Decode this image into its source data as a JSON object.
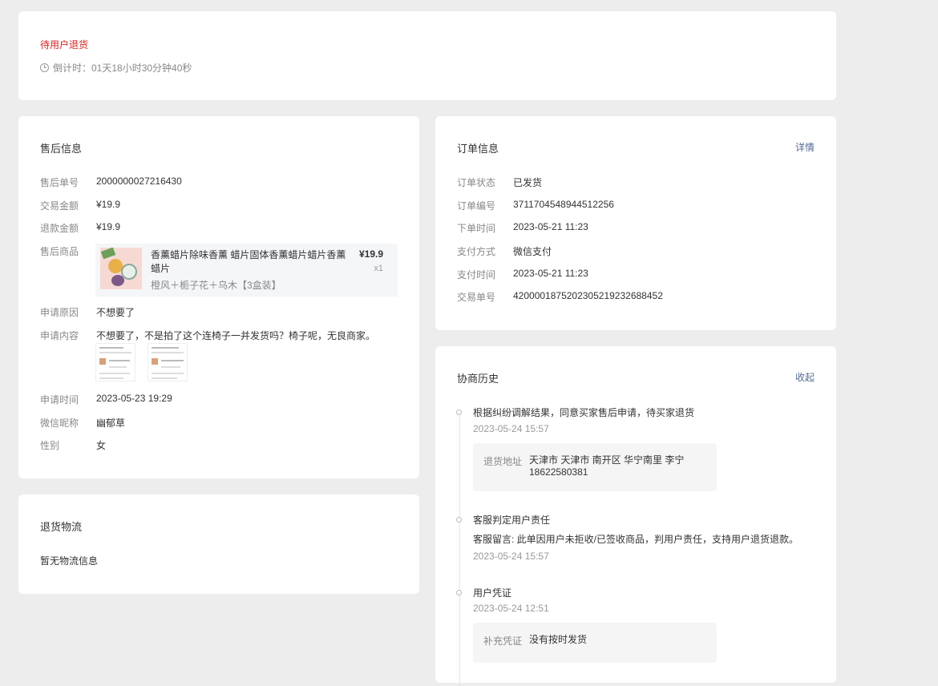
{
  "status": {
    "title": "待用户退货",
    "countdown": "倒计时：01天18小时30分钟40秒"
  },
  "after_sale": {
    "title": "售后信息",
    "rows": [
      {
        "label": "售后单号",
        "value": "2000000027216430"
      },
      {
        "label": "交易金额",
        "value": "¥19.9"
      },
      {
        "label": "退款金额",
        "value": "¥19.9"
      },
      {
        "label": "售后商品",
        "value": ""
      },
      {
        "label": "申请原因",
        "value": "不想要了"
      },
      {
        "label": "申请内容",
        "value": "不想要了，不是拍了这个连椅子一并发货吗？椅子呢，无良商家。"
      },
      {
        "label": "申请时间",
        "value": "2023-05-23 19:29"
      },
      {
        "label": "微信昵称",
        "value": "幽郁草"
      },
      {
        "label": "性别",
        "value": "女"
      }
    ],
    "product": {
      "name": "香薰蜡片除味香薰 蜡片固体香薰蜡片蜡片香薰 蜡片",
      "spec": "橙风＋栀子花＋乌木【3盒装】",
      "price": "¥19.9",
      "qty": "x1"
    }
  },
  "logistics": {
    "title": "退货物流",
    "empty_text": "暂无物流信息"
  },
  "order": {
    "title": "订单信息",
    "link": "详情",
    "rows": [
      {
        "label": "订单状态",
        "value": "已发货"
      },
      {
        "label": "订单编号",
        "value": "3711704548944512256"
      },
      {
        "label": "下单时间",
        "value": "2023-05-21 11:23"
      },
      {
        "label": "支付方式",
        "value": "微信支付"
      },
      {
        "label": "支付时间",
        "value": "2023-05-21 11:23"
      },
      {
        "label": "交易单号",
        "value": "4200001875202305219232688452"
      }
    ]
  },
  "history": {
    "title": "协商历史",
    "link": "收起",
    "items": [
      {
        "title": "根据纠纷调解结果，同意买家售后申请，待买家退货",
        "time": "2023-05-24 15:57",
        "box_label": "退货地址",
        "box_value": "天津市 天津市 南开区 华宁南里 李宁 18622580381"
      },
      {
        "title": "客服判定用户责任",
        "note": "客服留言: 此单因用户未拒收/已签收商品，判用户责任，支持用户退货退款。",
        "time": "2023-05-24 15:57"
      },
      {
        "title": "用户凭证",
        "time": "2023-05-24 12:51",
        "box_label": "补充凭证",
        "box_value": "没有按时发货"
      }
    ]
  }
}
